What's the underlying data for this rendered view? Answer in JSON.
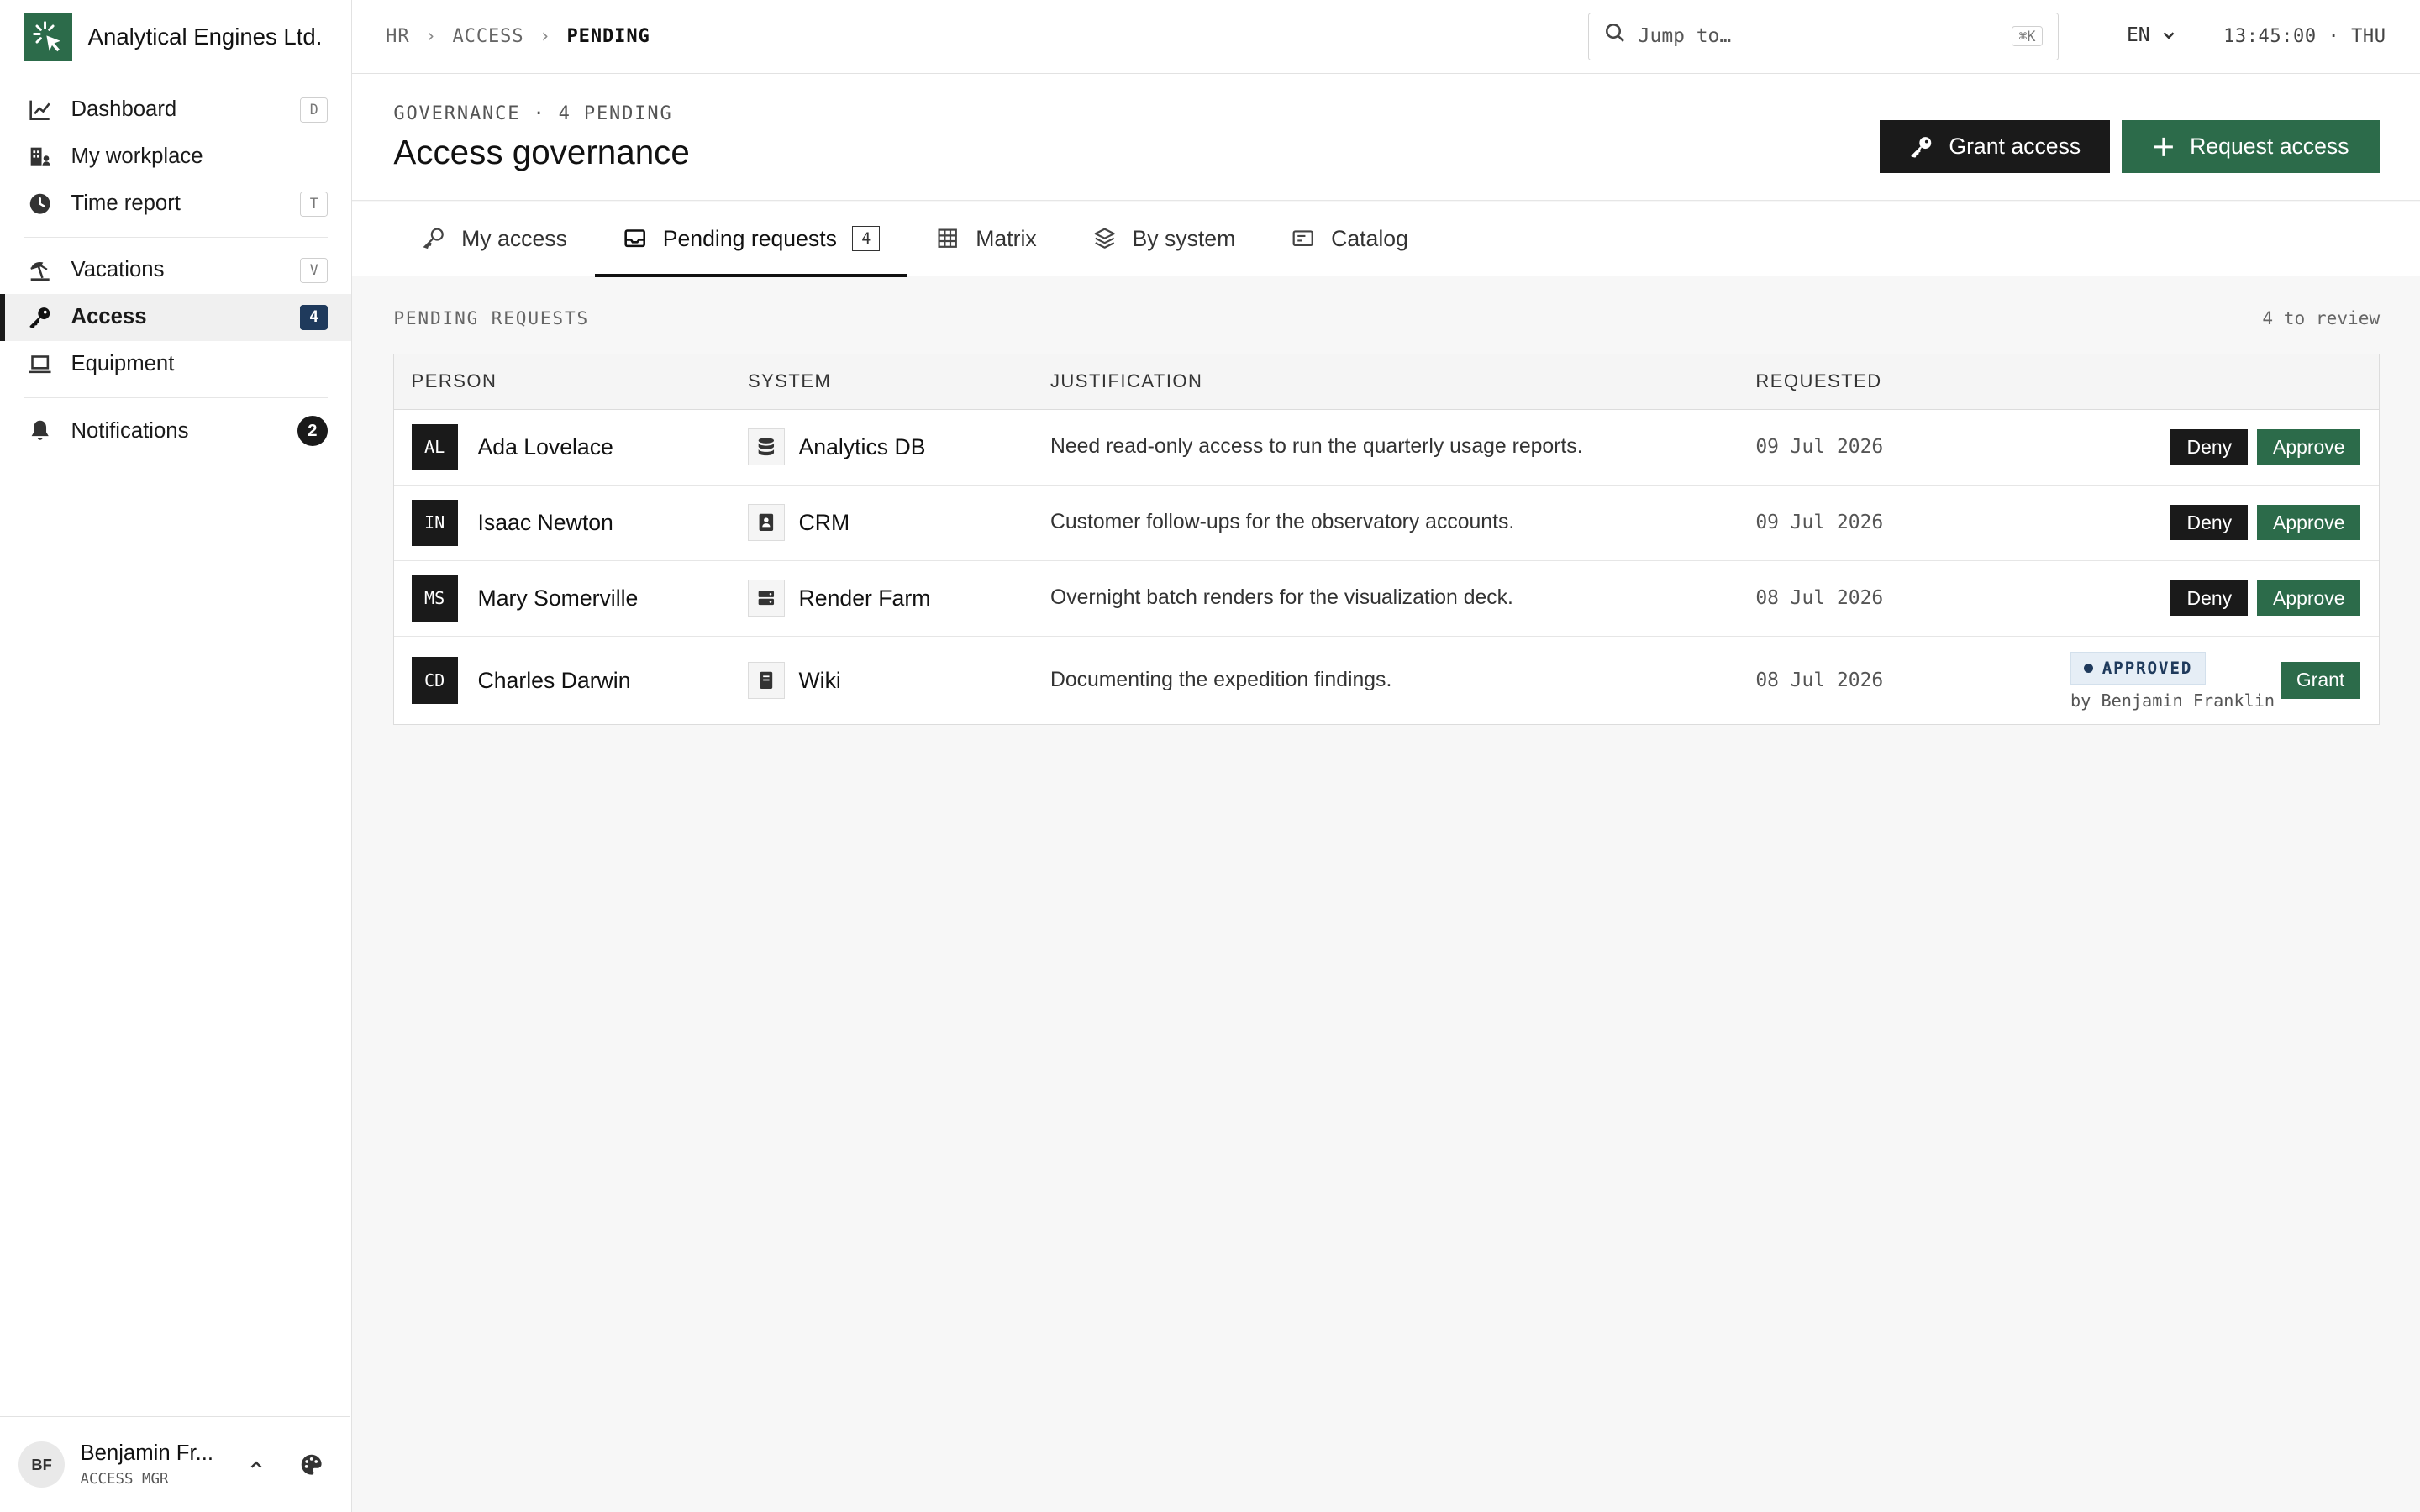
{
  "brand": {
    "name": "Analytical Engines Ltd."
  },
  "sidebar": {
    "items": [
      {
        "label": "Dashboard",
        "shortcut": "D"
      },
      {
        "label": "My workplace"
      },
      {
        "label": "Time report",
        "shortcut": "T"
      },
      {
        "label": "Vacations",
        "shortcut": "V"
      },
      {
        "label": "Access",
        "count": "4"
      },
      {
        "label": "Equipment"
      },
      {
        "label": "Notifications",
        "count": "2"
      }
    ],
    "user": {
      "initials": "BF",
      "name": "Benjamin Fr...",
      "role": "ACCESS MGR"
    }
  },
  "topbar": {
    "breadcrumbs": [
      "HR",
      "ACCESS",
      "PENDING"
    ],
    "search": {
      "placeholder": "Jump to…",
      "shortcut": "⌘K"
    },
    "language": "EN",
    "clock": "13:45:00 · THU"
  },
  "header": {
    "eyebrow": "GOVERNANCE · 4 PENDING",
    "title": "Access governance",
    "grant_access_label": "Grant access",
    "request_access_label": "Request access"
  },
  "tabs": [
    {
      "label": "My access"
    },
    {
      "label": "Pending requests",
      "count": "4"
    },
    {
      "label": "Matrix"
    },
    {
      "label": "By system"
    },
    {
      "label": "Catalog"
    }
  ],
  "pending": {
    "section_label": "PENDING REQUESTS",
    "meta": "4 to review",
    "columns": [
      "PERSON",
      "SYSTEM",
      "JUSTIFICATION",
      "REQUESTED"
    ],
    "rows": [
      {
        "initials": "AL",
        "person": "Ada Lovelace",
        "system": "Analytics DB",
        "justification": "Need read-only access to run the quarterly usage reports.",
        "requested": "09 Jul 2026",
        "deny": "Deny",
        "approve": "Approve"
      },
      {
        "initials": "IN",
        "person": "Isaac Newton",
        "system": "CRM",
        "justification": "Customer follow-ups for the observatory accounts.",
        "requested": "09 Jul 2026",
        "deny": "Deny",
        "approve": "Approve"
      },
      {
        "initials": "MS",
        "person": "Mary Somerville",
        "system": "Render Farm",
        "justification": "Overnight batch renders for the visualization deck.",
        "requested": "08 Jul 2026",
        "deny": "Deny",
        "approve": "Approve"
      },
      {
        "initials": "CD",
        "person": "Charles Darwin",
        "system": "Wiki",
        "justification": "Documenting the expedition findings.",
        "requested": "08 Jul 2026",
        "status": "APPROVED",
        "approved_by": "by Benjamin Franklin",
        "grant": "Grant"
      }
    ]
  }
}
